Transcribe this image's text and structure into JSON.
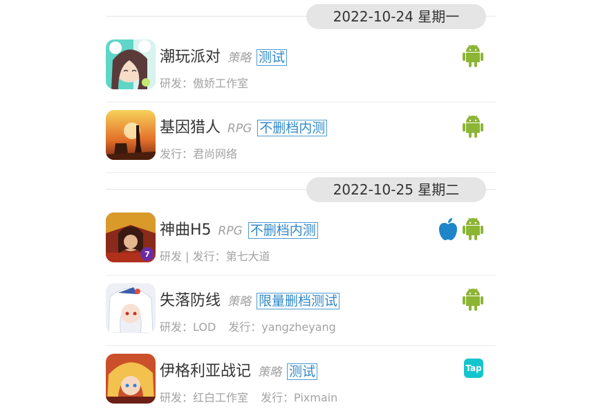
{
  "sections": [
    {
      "date": "2022-10-24 星期一",
      "games": [
        {
          "name": "潮玩派对",
          "genre": "策略",
          "tag": "测试",
          "meta": [
            "研发：傲娇工作室"
          ],
          "platforms": [
            "android"
          ],
          "icon": "anime-girl"
        },
        {
          "name": "基因猎人",
          "genre": "RPG",
          "tag": "不删档内测",
          "meta": [
            "发行：君尚网络"
          ],
          "platforms": [
            "android"
          ],
          "icon": "hunter-sunset"
        }
      ]
    },
    {
      "date": "2022-10-25 星期二",
      "games": [
        {
          "name": "神曲H5",
          "genre": "RPG",
          "tag": "不删档内测",
          "meta": [
            "研发 | 发行：第七大道"
          ],
          "platforms": [
            "ios",
            "android"
          ],
          "icon": "warrior-red"
        },
        {
          "name": "失落防线",
          "genre": "策略",
          "tag": "限量删档测试",
          "meta": [
            "研发：LOD",
            "发行：yangzheyang"
          ],
          "platforms": [
            "android"
          ],
          "icon": "white-hair-girl"
        },
        {
          "name": "伊格利亚战记",
          "genre": "策略",
          "tag": "测试",
          "meta": [
            "研发：红白工作室",
            "发行：Pixmain"
          ],
          "platforms": [
            "tap"
          ],
          "icon": "blonde-hero"
        }
      ]
    }
  ],
  "platform_labels": {
    "tap": "Tap"
  },
  "colors": {
    "android": "#8cb535",
    "ios": "#1e86c8",
    "tap": "#15c5ce",
    "tag": "#2f88c9"
  }
}
